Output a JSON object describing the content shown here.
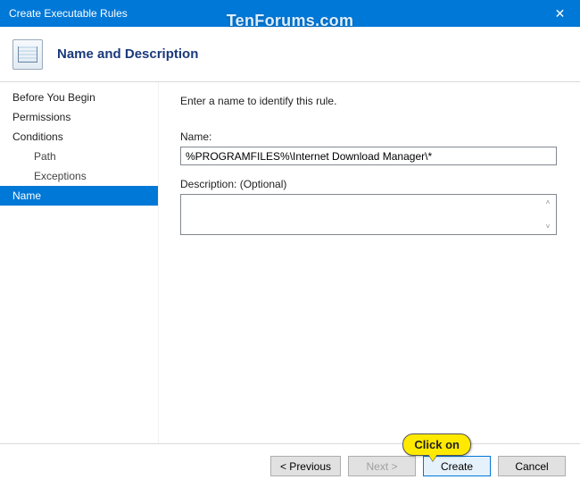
{
  "window": {
    "title": "Create Executable Rules"
  },
  "watermark": "TenForums.com",
  "header": {
    "title": "Name and Description"
  },
  "sidebar": {
    "items": [
      {
        "label": "Before You Begin",
        "kind": "top"
      },
      {
        "label": "Permissions",
        "kind": "top"
      },
      {
        "label": "Conditions",
        "kind": "top"
      },
      {
        "label": "Path",
        "kind": "sub"
      },
      {
        "label": "Exceptions",
        "kind": "sub"
      },
      {
        "label": "Name",
        "kind": "top",
        "selected": true
      }
    ]
  },
  "main": {
    "instruction": "Enter a name to identify this rule.",
    "name_label": "Name:",
    "name_value": "%PROGRAMFILES%\\Internet Download Manager\\*",
    "desc_label": "Description: (Optional)",
    "desc_value": ""
  },
  "footer": {
    "previous": "< Previous",
    "next": "Next >",
    "create": "Create",
    "cancel": "Cancel"
  },
  "callout": {
    "text": "Click on"
  }
}
